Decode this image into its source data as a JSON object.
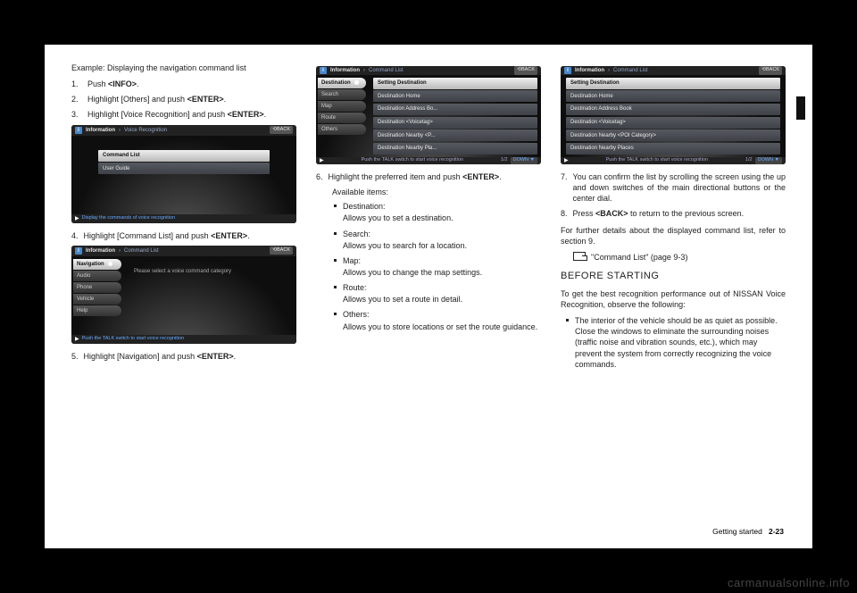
{
  "watermark": "carmanualsonline.info",
  "footer": {
    "section": "Getting started",
    "page": "2-23"
  },
  "col1": {
    "example": "Example: Displaying the navigation command list",
    "steps_a": [
      {
        "pre": "Push ",
        "btn": "<INFO>",
        "post": "."
      },
      {
        "pre": "Highlight [Others] and push ",
        "btn": "<ENTER>",
        "post": "."
      },
      {
        "pre": "Highlight [Voice Recognition] and push ",
        "btn": "<ENTER>",
        "post": "."
      }
    ],
    "ss1": {
      "crumb1": "Information",
      "crumb2": "Voice Recognition",
      "back": "BACK",
      "rows": [
        "Command List",
        "User Guide"
      ],
      "footer": "Display the commands of voice recognition"
    },
    "step4": {
      "n": "4.",
      "pre": "Highlight [Command List] and push ",
      "btn": "<ENTER>",
      "post": "."
    },
    "ss2": {
      "crumb1": "Information",
      "crumb2": "Command List",
      "back": "BACK",
      "left": [
        "Navigation",
        "Audio",
        "Phone",
        "Vehicle",
        "Help"
      ],
      "msg": "Please select a voice command category",
      "footer": "Push the TALK switch to start voice recognition"
    },
    "step5": {
      "n": "5.",
      "pre": "Highlight [Navigation] and push ",
      "btn": "<ENTER>",
      "post": "."
    }
  },
  "col2": {
    "ss3": {
      "crumb1": "Information",
      "crumb2": "Command List",
      "back": "BACK",
      "left": [
        "Destination",
        "Search",
        "Map",
        "Route",
        "Others"
      ],
      "rows": [
        "Setting Destination",
        "Destination Home",
        "Destination Address Bo...",
        "Destination <Voicetag>",
        "Destination Nearby <P...",
        "Destination Nearby Pla..."
      ],
      "page": "1/2",
      "down": "DOWN",
      "footer": "Push the TALK switch to start voice recognition"
    },
    "step6": {
      "n": "6.",
      "pre": "Highlight the preferred item and push ",
      "btn": "<ENTER>",
      "post": "."
    },
    "avail_label": "Available items:",
    "items": [
      {
        "t": "Destination:",
        "d": "Allows you to set a destination."
      },
      {
        "t": "Search:",
        "d": "Allows you to search for a location."
      },
      {
        "t": "Map:",
        "d": "Allows you to change the map settings."
      },
      {
        "t": "Route:",
        "d": "Allows you to set a route in detail."
      },
      {
        "t": "Others:",
        "d": "Allows you to store locations or set the route guidance."
      }
    ]
  },
  "col3": {
    "ss4": {
      "crumb1": "Information",
      "crumb2": "Command List",
      "back": "BACK",
      "rows": [
        "Setting Destination",
        "Destination Home",
        "Destination Address Book",
        "Destination <Voicetag>",
        "Destination Nearby <POI Category>",
        "Destination Nearby Places"
      ],
      "page": "1/2",
      "down": "DOWN",
      "footer": "Push the TALK switch to start voice recognition"
    },
    "step7": {
      "n": "7.",
      "text": "You can confirm the list by scrolling the screen using the up and down switches of the main directional buttons or the center dial."
    },
    "step8": {
      "n": "8.",
      "pre": "Press ",
      "btn": "<BACK>",
      "post": " to return to the previous screen."
    },
    "further": "For further details about the displayed command list, refer to section 9.",
    "ref": "\"Command List\" (page 9-3)",
    "h_before": "BEFORE STARTING",
    "before_p": "To get the best recognition performance out of NISSAN Voice Recognition, observe the following:",
    "before_items": [
      "The interior of the vehicle should be as quiet as possible. Close the windows to eliminate the surrounding noises (traffic noise and vibration sounds, etc.), which may prevent the system from correctly recognizing the voice commands."
    ]
  }
}
